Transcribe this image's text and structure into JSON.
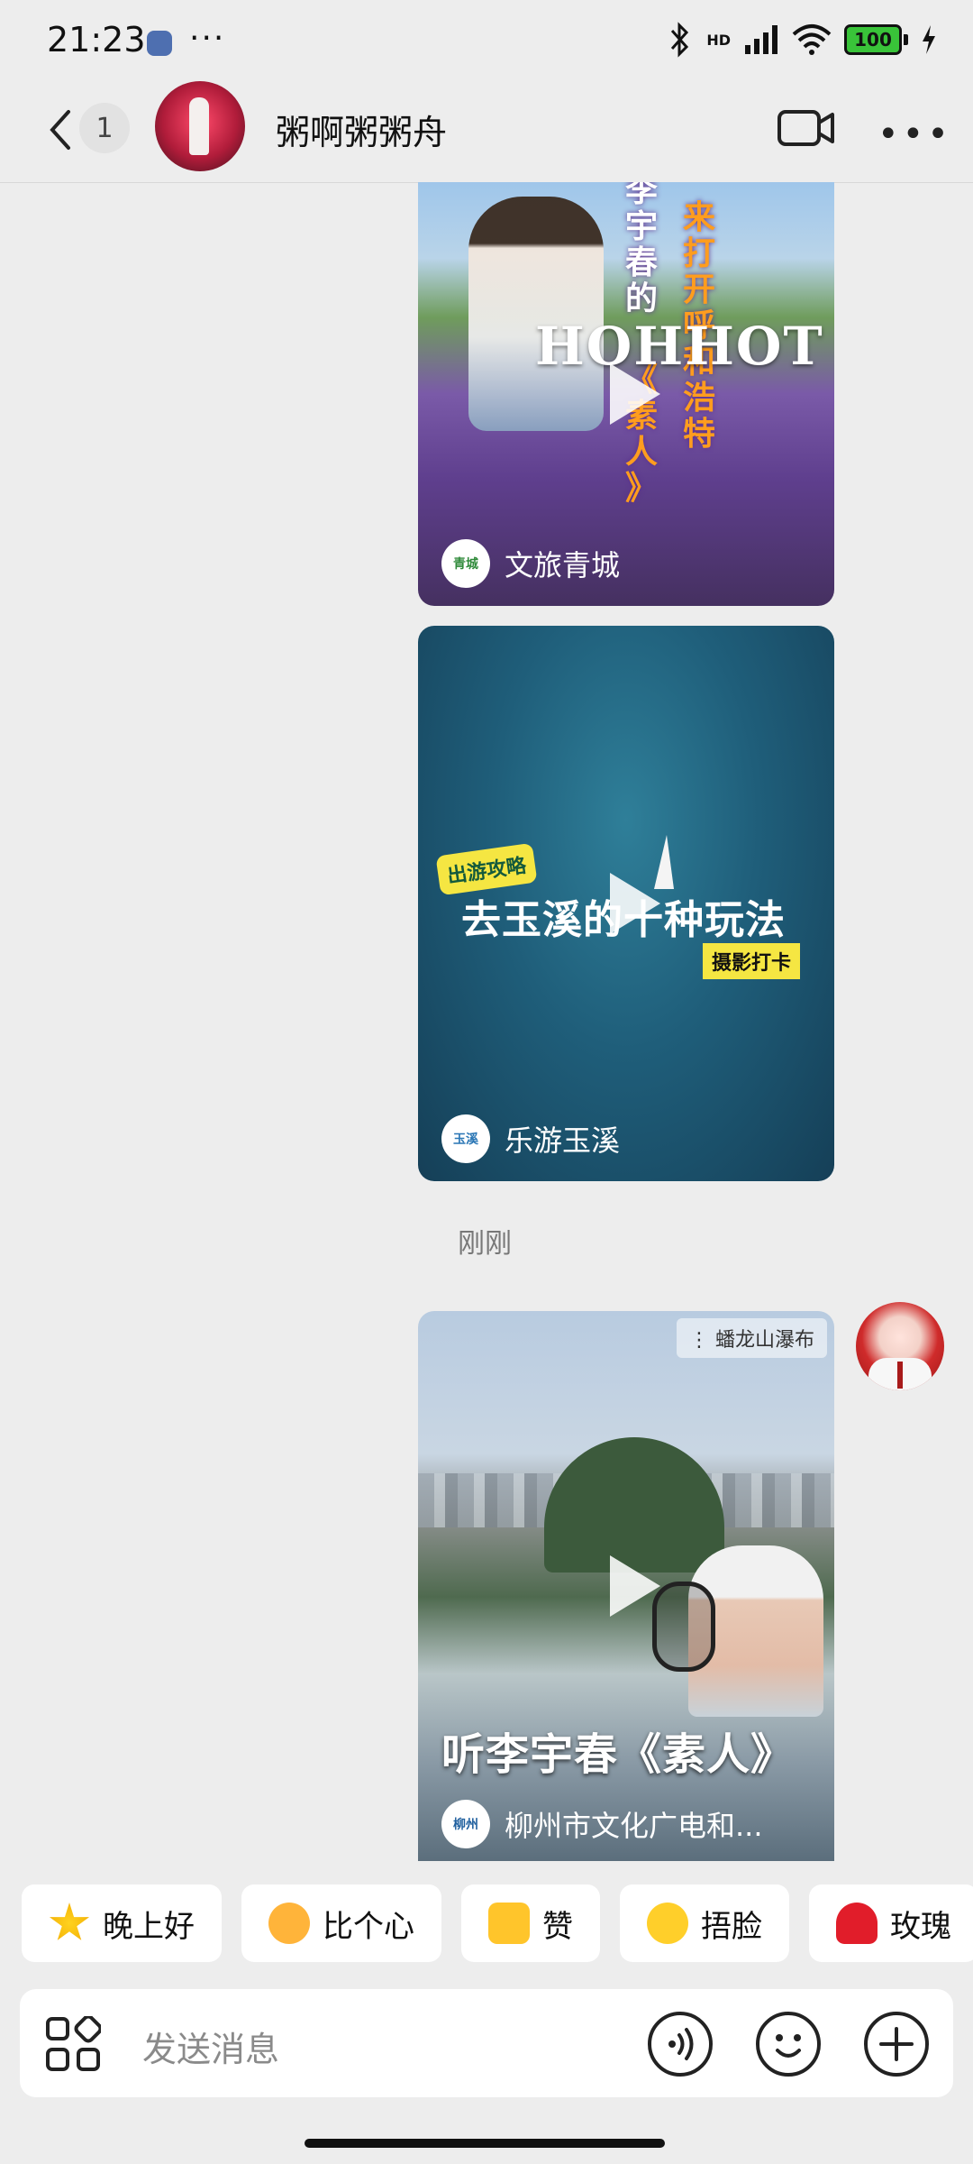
{
  "status_bar": {
    "time": "21:23",
    "more": "···",
    "net_label": "HD",
    "battery": "100",
    "colors": {
      "battery_fill": "#39c339"
    }
  },
  "header": {
    "unread_count": "1",
    "contact_name": "粥啊粥粥舟"
  },
  "messages": [
    {
      "type": "video-share",
      "source_name": "文旅青城",
      "overlay_vertical_left": "李宇春的",
      "overlay_vertical_mid": "来打开呼和浩特",
      "overlay_vertical_right": "《素人》",
      "overlay_text": "HOHHOT"
    },
    {
      "type": "video-share",
      "source_name": "乐游玉溪",
      "tag": "出游攻略",
      "overlay_title": "去玉溪的十种玩法",
      "overlay_sub": "摄影打卡"
    },
    {
      "type": "timestamp",
      "text": "刚刚"
    },
    {
      "type": "video-share",
      "source_name": "柳州市文化广电和...",
      "location": "蟠龙山瀑布",
      "overlay_title": "听李宇春《素人》"
    }
  ],
  "quick_replies": [
    {
      "icon": "star-emoji",
      "label": "晚上好"
    },
    {
      "icon": "heart-hands-emoji",
      "label": "比个心"
    },
    {
      "icon": "thumbs-up-emoji",
      "label": "赞"
    },
    {
      "icon": "laugh-cry-emoji",
      "label": "捂脸"
    },
    {
      "icon": "rose-emoji",
      "label": "玫瑰"
    }
  ],
  "input": {
    "placeholder": "发送消息"
  }
}
